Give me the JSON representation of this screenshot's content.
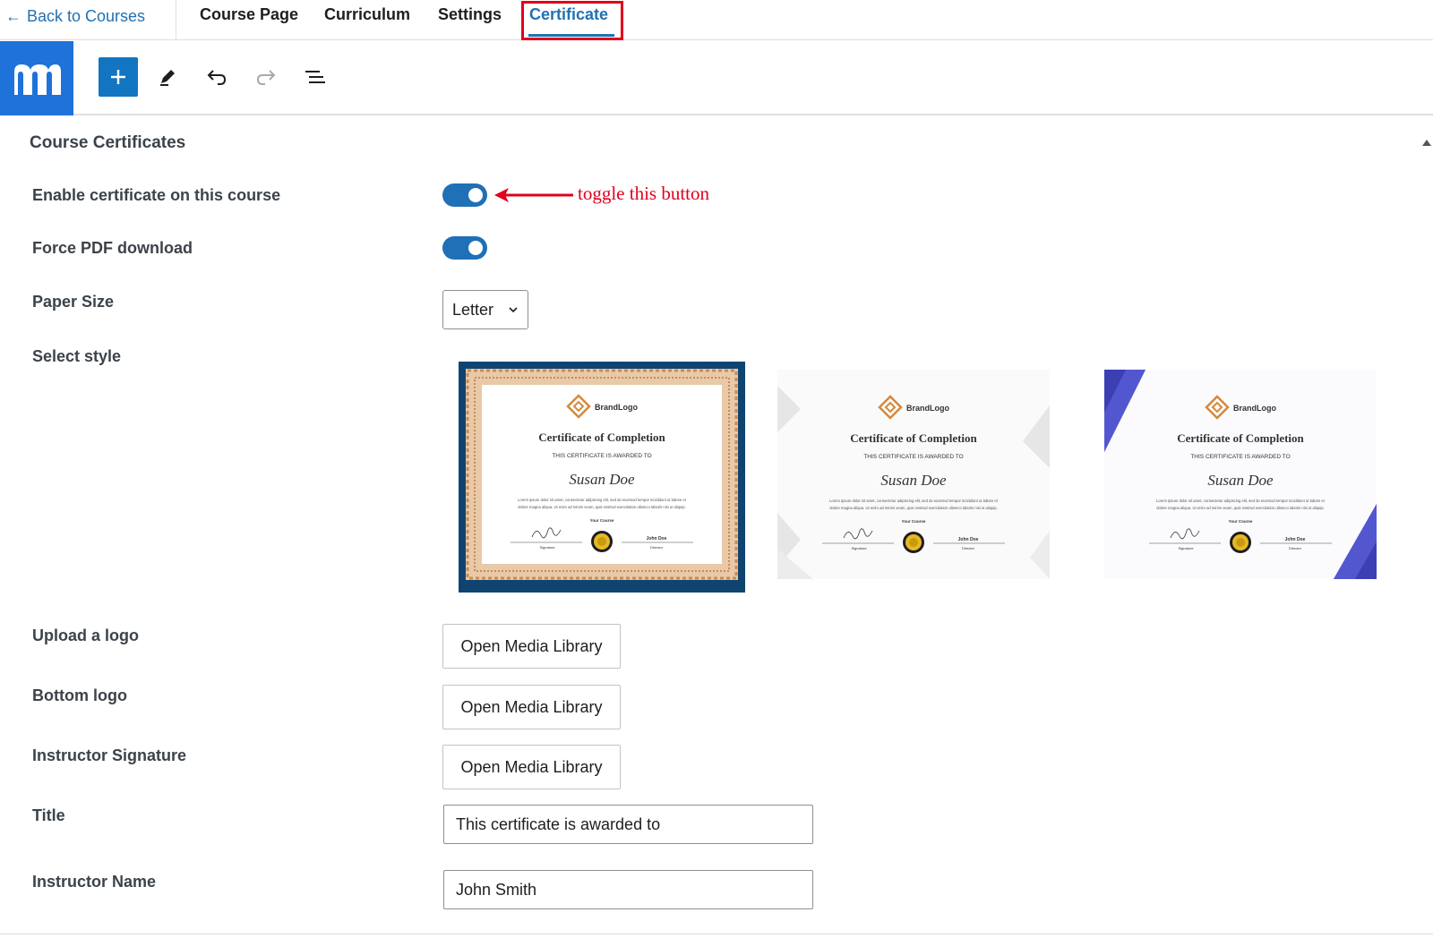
{
  "nav": {
    "back_label": "Back to Courses",
    "back_arrow": "←",
    "tabs": [
      "Course Page",
      "Curriculum",
      "Settings",
      "Certificate"
    ],
    "active_tab": "Certificate"
  },
  "toolbar": {
    "logo_letter": "m",
    "logo_color": "#1e72d9",
    "tools": [
      "add-icon",
      "pencil-icon",
      "undo-icon",
      "redo-icon",
      "list-view-icon"
    ]
  },
  "section": {
    "title": "Course Certificates"
  },
  "fields": {
    "enable_certificate": {
      "label": "Enable certificate on this course",
      "enabled": true
    },
    "force_pdf": {
      "label": "Force PDF download",
      "enabled": true
    },
    "paper_size": {
      "label": "Paper Size",
      "value": "Letter"
    },
    "select_style": {
      "label": "Select style",
      "selected_index": 0
    },
    "upload_logo": {
      "label": "Upload a logo",
      "button": "Open Media Library"
    },
    "bottom_logo": {
      "label": "Bottom logo",
      "button": "Open Media Library"
    },
    "instructor_signature": {
      "label": "Instructor Signature",
      "button": "Open Media Library"
    },
    "title": {
      "label": "Title",
      "value": "This certificate is awarded to"
    },
    "instructor_name": {
      "label": "Instructor Name",
      "value": "John Smith"
    }
  },
  "annotation": {
    "text": "toggle this button",
    "color": "#e0001b"
  },
  "certificate_template": {
    "brand": "BrandLogo",
    "heading": "Certificate of Completion",
    "awarded_line": "THIS CERTIFICATE IS AWARDED TO",
    "recipient": "Susan Doe",
    "body_line_1": "Lorem ipsum dolor sit amet, consectetur adipiscing elit, sed do eiusmod tempor incididunt ut labore et",
    "body_line_2": "dolore magna aliqua. Ut enim ad minim veam, quis nostrud exercitation ullamco laboris nisi ut aliquip.",
    "course": "Your Course",
    "signature_name": "John Doe",
    "signature_label": "Signature",
    "director_label": "Director"
  },
  "colors": {
    "accent": "#2271b1",
    "toggle_on": "#1f70b6",
    "highlight_box": "#e0001b"
  }
}
